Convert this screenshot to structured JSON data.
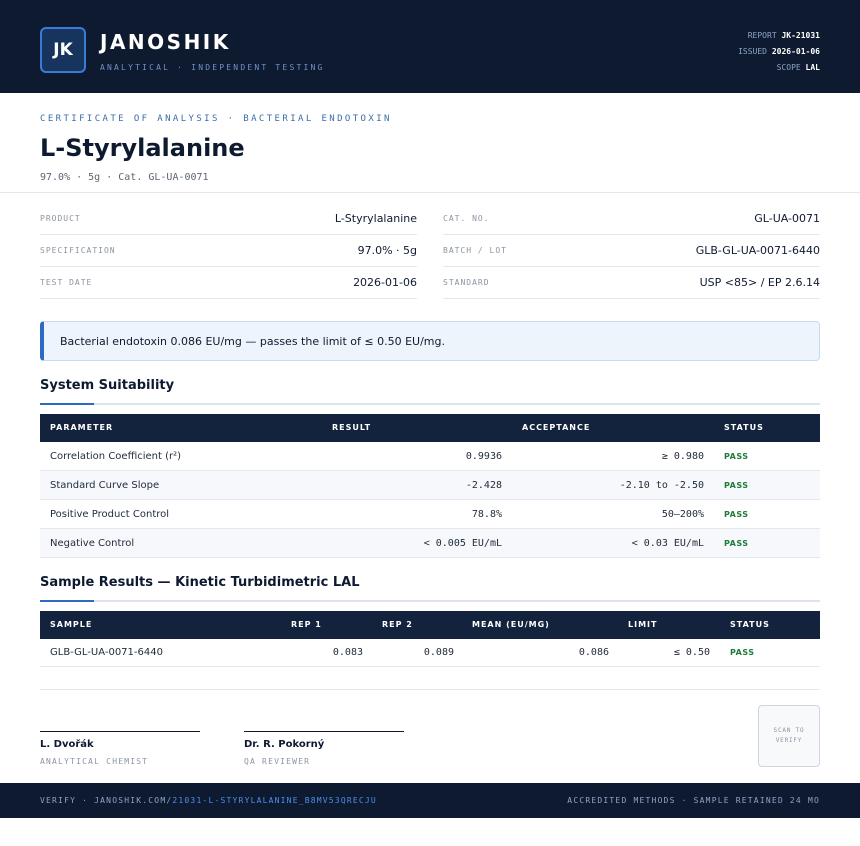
{
  "header": {
    "logo_initials": "JK",
    "brand": "JANOSHIK",
    "brand_sub": "ANALYTICAL · INDEPENDENT TESTING",
    "report_label": "REPORT",
    "report_value": "JK-21031",
    "issued_label": "ISSUED",
    "issued_value": "2026-01-06",
    "scope_label": "SCOPE",
    "scope_value": "LAL"
  },
  "title": {
    "cert_line": "CERTIFICATE OF ANALYSIS · BACTERIAL ENDOTOXIN",
    "name": "L-Styrylalanine",
    "subtitle": "97.0% · 5g  ·  Cat. GL-UA-0071"
  },
  "info": {
    "product_label": "PRODUCT",
    "product_value": "L-Styrylalanine",
    "spec_label": "SPECIFICATION",
    "spec_value": "97.0% · 5g",
    "date_label": "TEST DATE",
    "date_value": "2026-01-06",
    "cat_label": "CAT. NO.",
    "cat_value": "GL-UA-0071",
    "batch_label": "BATCH / LOT",
    "batch_value": "GLB-GL-UA-0071-6440",
    "standard_label": "STANDARD",
    "standard_value": "USP <85> / EP 2.6.14"
  },
  "banner": "Bacterial endotoxin 0.086 EU/mg — passes the limit of ≤ 0.50 EU/mg.",
  "suitability": {
    "title": "System Suitability",
    "headers": {
      "parameter": "PARAMETER",
      "result": "RESULT",
      "acceptance": "ACCEPTANCE",
      "status": "STATUS"
    },
    "rows": [
      {
        "parameter": "Correlation Coefficient (r²)",
        "result": "0.9936",
        "acceptance": "≥ 0.980",
        "status": "PASS"
      },
      {
        "parameter": "Standard Curve Slope",
        "result": "-2.428",
        "acceptance": "-2.10 to -2.50",
        "status": "PASS"
      },
      {
        "parameter": "Positive Product Control",
        "result": "78.8%",
        "acceptance": "50–200%",
        "status": "PASS"
      },
      {
        "parameter": "Negative Control",
        "result": "< 0.005 EU/mL",
        "acceptance": "< 0.03 EU/mL",
        "status": "PASS"
      }
    ]
  },
  "samples": {
    "title": "Sample Results — Kinetic Turbidimetric LAL",
    "headers": {
      "sample": "SAMPLE",
      "rep1": "REP 1",
      "rep2": "REP 2",
      "mean": "MEAN (EU/MG)",
      "limit": "LIMIT",
      "status": "STATUS"
    },
    "rows": [
      {
        "sample": "GLB-GL-UA-0071-6440",
        "rep1": "0.083",
        "rep2": "0.089",
        "mean": "0.086",
        "limit": "≤ 0.50",
        "status": "PASS"
      }
    ]
  },
  "signatures": [
    {
      "name": "L. Dvořák",
      "role": "ANALYTICAL CHEMIST"
    },
    {
      "name": "Dr. R. Pokorný",
      "role": "QA REVIEWER"
    }
  ],
  "qr_text": "SCAN TO VERIFY",
  "footer": {
    "verify_prefix": "VERIFY · JANOSHIK.COM/",
    "verify_link": "21031-L-STYRYLALANINE_B8MV53QRECJU",
    "right": "ACCREDITED METHODS · SAMPLE RETAINED 24 MO"
  },
  "colors": {
    "navy": "#0e1a30",
    "accent": "#2c6bc2",
    "pass": "#1d7a3a"
  }
}
